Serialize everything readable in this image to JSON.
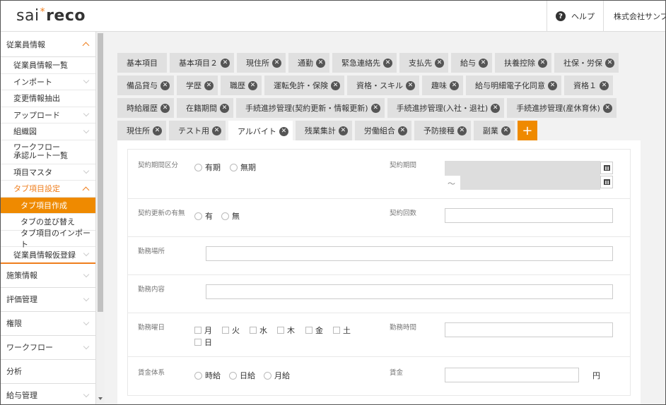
{
  "header": {
    "logo_left": "sai",
    "logo_star": "*",
    "logo_right": "reco",
    "help_label": "ヘルプ",
    "company": "株式会社サンプル"
  },
  "sidebar": {
    "section_employee": "従業員情報",
    "items": [
      "従業員情報一覧",
      "インポート",
      "変更情報抽出",
      "アップロード",
      "組織図"
    ],
    "workflow_line1": "ワークフロー",
    "workflow_line2": "承認ルート一覧",
    "item_master": "項目マスタ",
    "tab_settings": "タブ項目設定",
    "tab_sub": [
      "タブ項目作成",
      "タブの並び替え",
      "タブ項目のインポート"
    ],
    "temp_register": "従業員情報仮登録",
    "main_items": [
      "施策情報",
      "評価管理",
      "権限",
      "ワークフロー",
      "分析",
      "給与管理"
    ]
  },
  "tabs": {
    "row1": [
      "基本項目",
      "基本項目２",
      "現住所",
      "通勤",
      "緊急連絡先",
      "支払先",
      "給与",
      "扶養控除",
      "社保・労保"
    ],
    "row2": [
      "備品貸与",
      "学歴",
      "職歴",
      "運転免許・保険",
      "資格・スキル",
      "趣味",
      "給与明細電子化同意",
      "資格１"
    ],
    "row3": [
      "時給履歴",
      "在籍期間",
      "手続進捗管理(契約更新・情報更新)",
      "手続進捗管理(入社・退社)",
      "手続進捗管理(産休育休)"
    ],
    "row4": [
      "現住所",
      "テスト用",
      "アルバイト",
      "残業集計",
      "労働組合",
      "予防接種",
      "副業"
    ],
    "close_glyph": "✕",
    "add_glyph": "+"
  },
  "form": {
    "contract_period_type": "契約期間区分",
    "opt_fixed": "有期",
    "opt_unfixed": "無期",
    "contract_period": "契約期間",
    "tilde": "～",
    "renewal_label": "契約更新の有無",
    "opt_yes": "有",
    "opt_no": "無",
    "contract_count": "契約回数",
    "work_place": "勤務場所",
    "work_content": "勤務内容",
    "work_days": "勤務曜日",
    "days": [
      "月",
      "火",
      "水",
      "木",
      "金",
      "土",
      "日"
    ],
    "work_hours": "勤務時間",
    "wage_system": "賃金体系",
    "opt_hourly": "時給",
    "opt_daily": "日給",
    "opt_monthly": "月給",
    "wage": "賃金",
    "yen": "円"
  }
}
